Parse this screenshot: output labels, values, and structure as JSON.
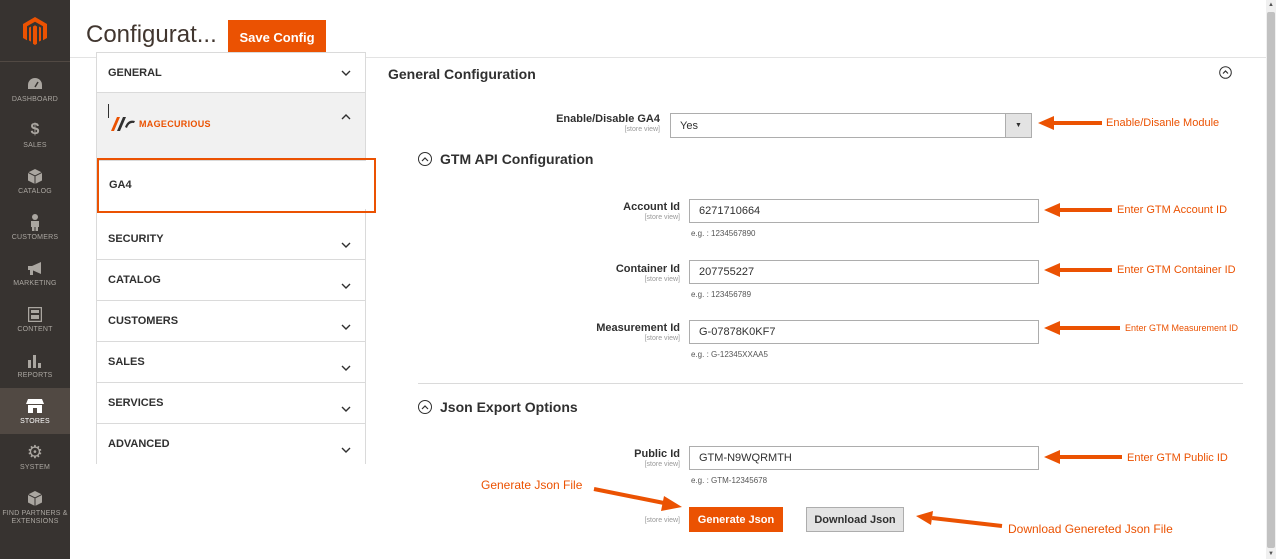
{
  "nav": {
    "items": [
      {
        "label": "DASHBOARD",
        "icon": "dashboard-icon"
      },
      {
        "label": "SALES",
        "icon": "dollar-icon"
      },
      {
        "label": "CATALOG",
        "icon": "cube-icon"
      },
      {
        "label": "CUSTOMERS",
        "icon": "person-icon"
      },
      {
        "label": "MARKETING",
        "icon": "megaphone-icon"
      },
      {
        "label": "CONTENT",
        "icon": "content-icon"
      },
      {
        "label": "REPORTS",
        "icon": "bar-chart-icon"
      },
      {
        "label": "STORES",
        "icon": "store-icon"
      },
      {
        "label": "SYSTEM",
        "icon": "gear-icon"
      },
      {
        "label": "FIND PARTNERS & EXTENSIONS",
        "icon": "box-icon"
      }
    ],
    "active": "STORES"
  },
  "header": {
    "title": "Configurat...",
    "save_label": "Save Config"
  },
  "tabs": {
    "general": "GENERAL",
    "brand": "MAGECURIOUS",
    "ga4": "GA4",
    "security": "SECURITY",
    "catalog": "CATALOG",
    "customers": "CUSTOMERS",
    "sales": "SALES",
    "services": "SERVICES",
    "advanced": "ADVANCED"
  },
  "main": {
    "section_title": "General Configuration",
    "scope": "[store view]",
    "enable": {
      "label": "Enable/Disable GA4",
      "value": "Yes"
    },
    "gtm_title": "GTM API Configuration",
    "account": {
      "label": "Account Id",
      "value": "6271710664",
      "note": "e.g. : 1234567890"
    },
    "container": {
      "label": "Container Id",
      "value": "207755227",
      "note": "e.g. : 123456789"
    },
    "measurement": {
      "label": "Measurement Id",
      "value": "G-07878K0KF7",
      "note": "e.g. : G-12345XXAA5"
    },
    "json_title": "Json Export Options",
    "public": {
      "label": "Public Id",
      "value": "GTM-N9WQRMTH",
      "note": "e.g. : GTM-12345678"
    },
    "generate_label": "Generate Json",
    "download_label": "Download Json"
  },
  "annotations": {
    "enable": "Enable/Disanle Module",
    "account": "Enter GTM Account ID",
    "container": "Enter GTM Container ID",
    "measurement": "Enter GTM Measurement ID",
    "public": "Enter GTM Public ID",
    "generate": "Generate Json File",
    "download": "Download Genereted Json File"
  },
  "colors": {
    "accent": "#eb5202",
    "nav_bg": "#373330"
  }
}
